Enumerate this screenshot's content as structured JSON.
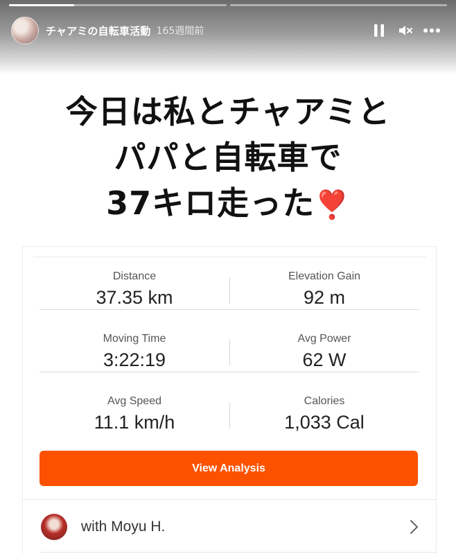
{
  "story": {
    "progress_segments": [
      0.3,
      0
    ],
    "user": "チャアミの自転車活動",
    "time_ago": "165週間前"
  },
  "caption": {
    "line1": "今日は私とチャアミと",
    "line2": "パパと自転車で",
    "line3": "37キロ走った",
    "emoji": "❣️"
  },
  "stats": [
    {
      "left_label": "Distance",
      "left_value": "37.35 km",
      "right_label": "Elevation Gain",
      "right_value": "92 m"
    },
    {
      "left_label": "Moving Time",
      "left_value": "3:22:19",
      "right_label": "Avg Power",
      "right_value": "62 W"
    },
    {
      "left_label": "Avg Speed",
      "left_value": "11.1 km/h",
      "right_label": "Calories",
      "right_value": "1,033 Cal"
    }
  ],
  "button": {
    "label": "View Analysis"
  },
  "with": {
    "text": "with Moyu H."
  },
  "colors": {
    "accent": "#fc5200"
  }
}
